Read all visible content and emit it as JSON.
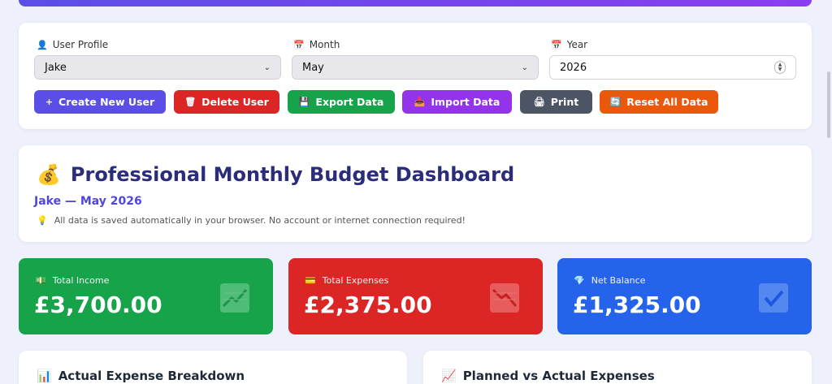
{
  "controls": {
    "user_label": "User Profile",
    "user_value": "Jake",
    "month_label": "Month",
    "month_value": "May",
    "year_label": "Year",
    "year_value": "2026",
    "buttons": [
      {
        "label": "Create New User",
        "icon": "+",
        "color": "#5b4ee6"
      },
      {
        "label": "Delete User",
        "icon": "🗑",
        "color": "#dc2626"
      },
      {
        "label": "Export Data",
        "icon": "💾",
        "color": "#16a34a"
      },
      {
        "label": "Import Data",
        "icon": "📥",
        "color": "#9333ea"
      },
      {
        "label": "Print",
        "icon": "🖨",
        "color": "#4b5563"
      },
      {
        "label": "Reset All Data",
        "icon": "🔄",
        "color": "#ea580c"
      }
    ]
  },
  "hero": {
    "emoji": "💰",
    "title": "Professional Monthly Budget Dashboard",
    "subtitle": "Jake — May 2026",
    "note_icon": "💡",
    "note": "All data is saved automatically in your browser. No account or internet connection required!"
  },
  "cards": [
    {
      "label": "Total Income",
      "icon": "💵",
      "value": "£3,700.00",
      "color": "#16a34a"
    },
    {
      "label": "Total Expenses",
      "icon": "💳",
      "value": "£2,375.00",
      "color": "#dc2626"
    },
    {
      "label": "Net Balance",
      "icon": "💎",
      "value": "£1,325.00",
      "color": "#2563eb"
    }
  ],
  "sections": [
    {
      "icon": "📊",
      "title": "Actual Expense Breakdown"
    },
    {
      "icon": "📈",
      "title": "Planned vs Actual Expenses"
    }
  ]
}
